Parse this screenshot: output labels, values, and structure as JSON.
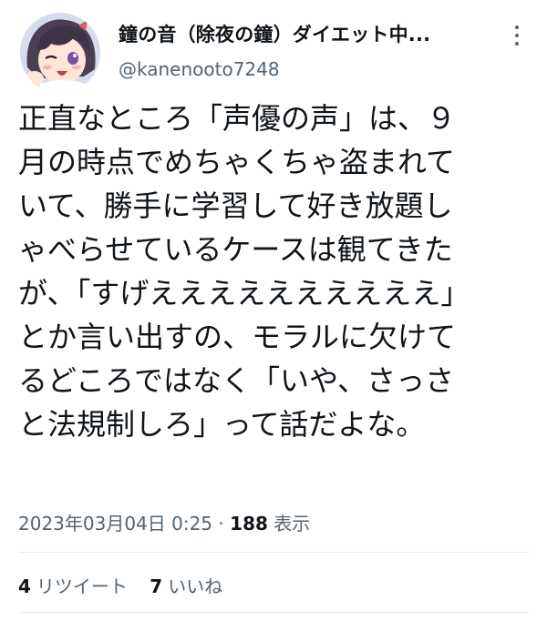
{
  "header": {
    "display_name": "鐘の音（除夜の鐘）ダイエット中...",
    "handle": "@kanenooto7248",
    "more_icon": "more-options-icon"
  },
  "tweet": {
    "lines": [
      "正直なところ「声優の声」は、９",
      "月の時点でめちゃくちゃ盗まれて",
      "いて、勝手に学習して好き放題し",
      "ゃべらせているケースは観てきた",
      "が、「すげええええええええええ」",
      "とか言い出すの、モラルに欠けて",
      "るどころではなく「いや、さっさ",
      "と法規制しろ」って話だよな。"
    ]
  },
  "meta": {
    "timestamp": "2023年03月04日 0:25",
    "separator": " · ",
    "views_count": "188",
    "views_label": " 表示"
  },
  "stats": {
    "retweets_count": "4",
    "retweets_label": "リツイート",
    "likes_count": "7",
    "likes_label": "いいね"
  }
}
